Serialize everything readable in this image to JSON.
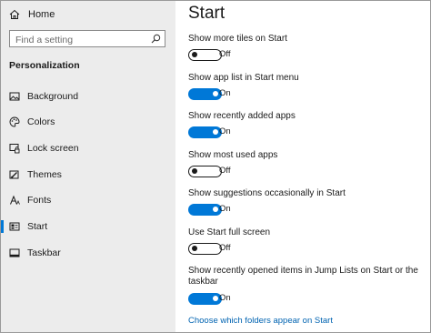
{
  "sidebar": {
    "home_label": "Home",
    "search_placeholder": "Find a setting",
    "section_title": "Personalization",
    "items": [
      {
        "label": "Background",
        "icon": "picture-icon"
      },
      {
        "label": "Colors",
        "icon": "palette-icon"
      },
      {
        "label": "Lock screen",
        "icon": "lock-screen-icon"
      },
      {
        "label": "Themes",
        "icon": "brush-icon"
      },
      {
        "label": "Fonts",
        "icon": "font-icon"
      },
      {
        "label": "Start",
        "icon": "start-icon",
        "active": true
      },
      {
        "label": "Taskbar",
        "icon": "taskbar-icon"
      }
    ]
  },
  "main": {
    "title": "Start",
    "settings": [
      {
        "label": "Show more tiles on Start",
        "state": "Off",
        "on": false
      },
      {
        "label": "Show app list in Start menu",
        "state": "On",
        "on": true
      },
      {
        "label": "Show recently added apps",
        "state": "On",
        "on": true
      },
      {
        "label": "Show most used apps",
        "state": "Off",
        "on": false
      },
      {
        "label": "Show suggestions occasionally in Start",
        "state": "On",
        "on": true
      },
      {
        "label": "Use Start full screen",
        "state": "Off",
        "on": false
      },
      {
        "label": "Show recently opened items in Jump Lists on Start or the taskbar",
        "state": "On",
        "on": true
      }
    ],
    "link": "Choose which folders appear on Start"
  },
  "colors": {
    "accent": "#0078d7",
    "link": "#0063b1",
    "sidebar_bg": "#ececec"
  }
}
